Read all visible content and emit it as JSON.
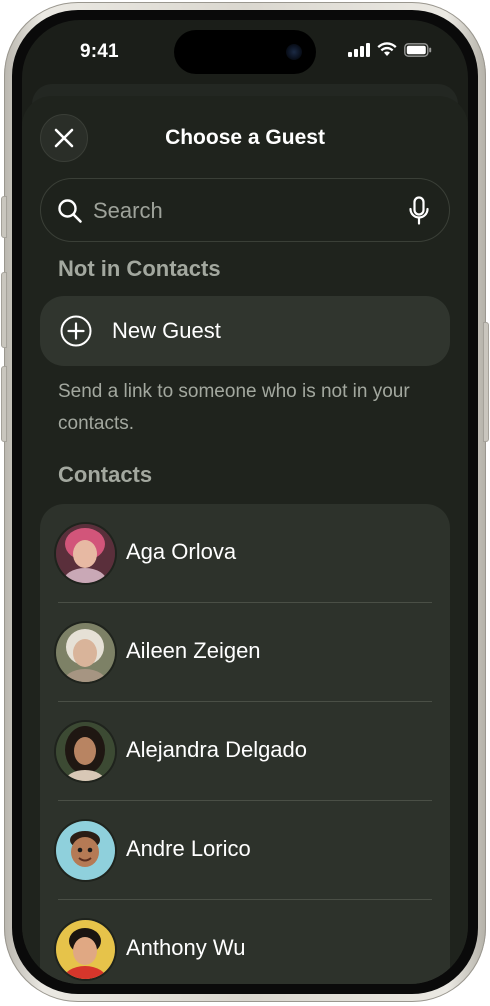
{
  "status": {
    "time": "9:41"
  },
  "header": {
    "title": "Choose a Guest",
    "close_icon": "close-icon"
  },
  "search": {
    "placeholder": "Search",
    "value": "",
    "icon": "search-icon",
    "mic_icon": "microphone-icon"
  },
  "not_in_contacts": {
    "heading": "Not in Contacts",
    "new_guest_label": "New Guest",
    "new_guest_icon": "plus-circle-icon",
    "hint": "Send a link to someone who is not in your contacts."
  },
  "contacts": {
    "heading": "Contacts",
    "items": [
      {
        "name": "Aga Orlova",
        "avatar": "photo-avatar"
      },
      {
        "name": "Aileen Zeigen",
        "avatar": "photo-avatar"
      },
      {
        "name": "Alejandra Delgado",
        "avatar": "photo-avatar"
      },
      {
        "name": "Andre Lorico",
        "avatar": "memoji-avatar"
      },
      {
        "name": "Anthony Wu",
        "avatar": "photo-avatar"
      }
    ]
  },
  "colors": {
    "background": "#1f231d",
    "card": "#2d322b",
    "secondary_text": "#a3a89f"
  }
}
